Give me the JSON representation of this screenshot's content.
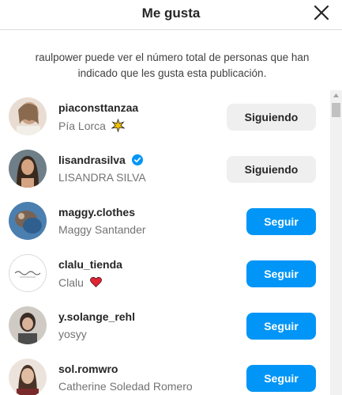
{
  "dialog": {
    "title": "Me gusta",
    "notice": "raulpower puede ver el número total de personas que han indicado que les gusta esta publicación."
  },
  "users": [
    {
      "username": "piaconsttanzaa",
      "fullname": "Pía Lorca",
      "verified": false,
      "emoji": "sparkle-star",
      "button": "Siguiendo",
      "following": true
    },
    {
      "username": "lisandrasilva",
      "fullname": "LISANDRA SILVA",
      "verified": true,
      "emoji": null,
      "button": "Siguiendo",
      "following": true
    },
    {
      "username": "maggy.clothes",
      "fullname": "Maggy Santander",
      "verified": false,
      "emoji": null,
      "button": "Seguir",
      "following": false
    },
    {
      "username": "clalu_tienda",
      "fullname": "Clalu",
      "verified": false,
      "emoji": "heart",
      "button": "Seguir",
      "following": false
    },
    {
      "username": "y.solange_rehl",
      "fullname": "yosyy",
      "verified": false,
      "emoji": null,
      "button": "Seguir",
      "following": false
    },
    {
      "username": "sol.romwro",
      "fullname": "Catherine Soledad Romero",
      "verified": false,
      "emoji": null,
      "button": "Seguir",
      "following": false
    }
  ],
  "colors": {
    "follow_button": "#0095f6",
    "following_button": "#efefef",
    "verified_badge": "#0095f6"
  }
}
